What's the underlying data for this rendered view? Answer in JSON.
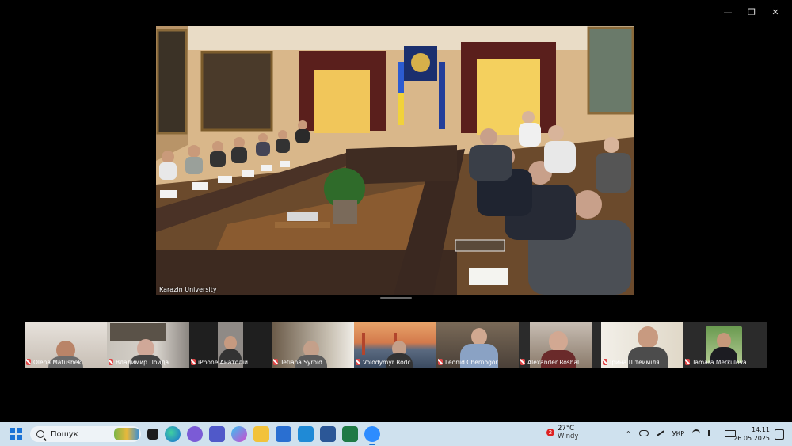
{
  "window_controls": [
    "—",
    "❐",
    "✕"
  ],
  "main_video": {
    "speaker_label": "Karazin University"
  },
  "participants": [
    {
      "name": "Olena Matushek",
      "muted": true
    },
    {
      "name": "Владимир Пойда",
      "muted": true
    },
    {
      "name": "iPhone Анатолій",
      "muted": true
    },
    {
      "name": "Tetiana Syroid",
      "muted": true
    },
    {
      "name": "Volodymyr Rodc...",
      "muted": true
    },
    {
      "name": "Leonid Chernogor",
      "muted": true
    },
    {
      "name": "Alexander Roshal",
      "muted": true
    },
    {
      "name": "Ірина Штейміля...",
      "muted": true
    },
    {
      "name": "Tamara Merkulova",
      "muted": true
    }
  ],
  "taskbar": {
    "search_placeholder": "Пошук",
    "apps": [
      "file-explorer",
      "edge",
      "viber",
      "teams",
      "copilot",
      "folder",
      "store",
      "mail",
      "word",
      "excel",
      "zoom"
    ],
    "weather": {
      "badge": "2",
      "temp": "27°C",
      "condition": "Windy"
    },
    "tray": {
      "chevron": "⌃",
      "lang": "УКР"
    },
    "clock": {
      "time": "14:11",
      "date": "26.05.2025"
    }
  }
}
